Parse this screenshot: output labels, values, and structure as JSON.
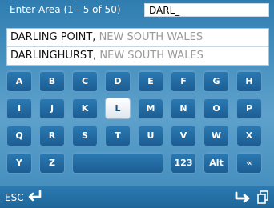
{
  "header": {
    "label": "Enter Area (1 - 5 of 50)",
    "input_value": "DARL_"
  },
  "results": [
    {
      "suburb": "DARLING POINT",
      "sep": ",",
      "state": " NEW SOUTH WALES"
    },
    {
      "suburb": "DARLINGHURST",
      "sep": ",",
      "state": " NEW SOUTH WALES"
    }
  ],
  "keyboard": {
    "row1": [
      "A",
      "B",
      "C",
      "D",
      "E",
      "F",
      "G",
      "H"
    ],
    "row2": [
      "I",
      "J",
      "K",
      "L",
      "M",
      "N",
      "O",
      "P"
    ],
    "row3": [
      "Q",
      "R",
      "S",
      "T",
      "U",
      "V",
      "W",
      "X"
    ],
    "row4": [
      "Y",
      "Z",
      "",
      "123",
      "Alt",
      "«"
    ],
    "selected_key": "L"
  },
  "footer": {
    "esc_label": "ESC",
    "icons": [
      "back-arrow-icon",
      "forward-arrow-icon",
      "pages-icon"
    ]
  },
  "colors": {
    "background": "#3d86b4",
    "key": "#1f6aa0",
    "selected_key": "#ffffff"
  }
}
